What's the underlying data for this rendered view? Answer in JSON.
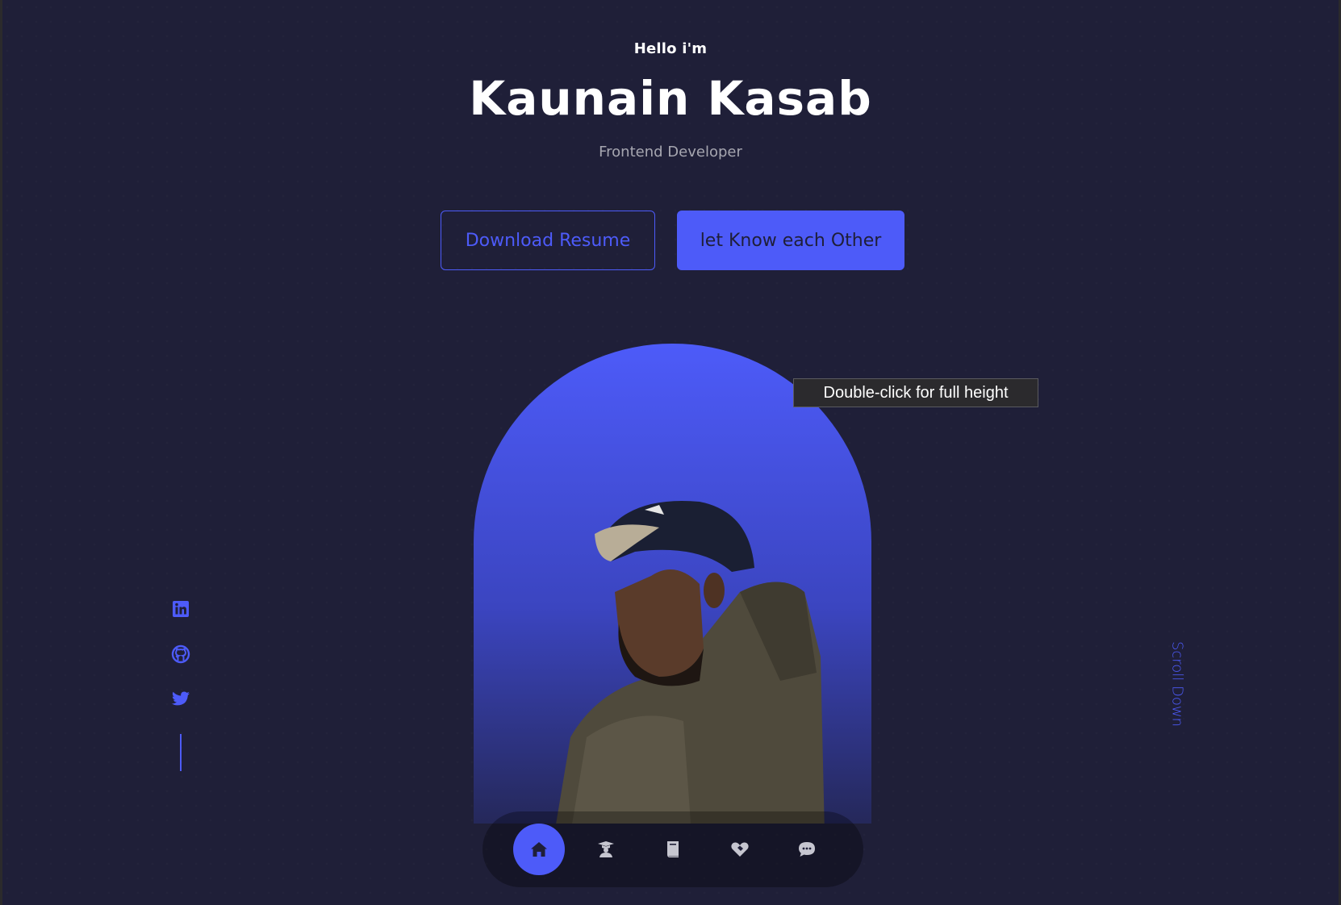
{
  "hero": {
    "greeting": "Hello i'm",
    "name": "Kaunain Kasab",
    "role": "Frontend Developer"
  },
  "cta": {
    "download_label": "Download Resume",
    "contact_label": "let Know each Other"
  },
  "tooltip": {
    "text": "Double-click for full height"
  },
  "socials": [
    {
      "icon": "linkedin-icon"
    },
    {
      "icon": "github-icon"
    },
    {
      "icon": "twitter-icon"
    }
  ],
  "scroll": {
    "label": "Scroll Down"
  },
  "nav": {
    "items": [
      {
        "icon": "home-icon",
        "active": true
      },
      {
        "icon": "graduation-icon",
        "active": false
      },
      {
        "icon": "book-icon",
        "active": false
      },
      {
        "icon": "handshake-icon",
        "active": false
      },
      {
        "icon": "chat-icon",
        "active": false
      }
    ]
  },
  "colors": {
    "background": "#1f1f38",
    "primary": "#4d5bf9",
    "text": "#ffffff",
    "muted_text": "rgba(255,255,255,0.6)"
  }
}
